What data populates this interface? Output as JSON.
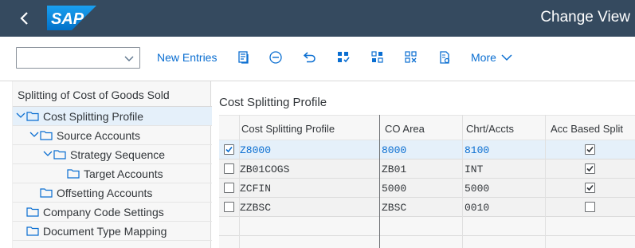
{
  "shell": {
    "title": "Change View",
    "logo_text": "SAP"
  },
  "toolbar": {
    "select_value": "",
    "new_entries": "New Entries",
    "more": "More",
    "icons": [
      "copy-as-icon",
      "delete-icon",
      "undo-icon",
      "select-all-icon",
      "select-block-icon",
      "deselect-all-icon",
      "print-icon"
    ]
  },
  "tree": {
    "header": "Splitting of Cost of Goods Sold",
    "items": [
      {
        "label": "Cost Splitting Profile",
        "level": 0,
        "expanded": true,
        "selected": true
      },
      {
        "label": "Source Accounts",
        "level": 1,
        "expanded": true
      },
      {
        "label": "Strategy Sequence",
        "level": 2,
        "expanded": true
      },
      {
        "label": "Target Accounts",
        "level": 3
      },
      {
        "label": "Offsetting Accounts",
        "level": 1
      },
      {
        "label": "Company Code Settings",
        "level": 0
      },
      {
        "label": "Document Type Mapping",
        "level": 0
      }
    ]
  },
  "table": {
    "title": "Cost Splitting Profile",
    "columns": [
      "Cost Splitting Profile",
      "CO Area",
      "Chrt/Accts",
      "Acc Based Split"
    ],
    "rows": [
      {
        "selected": true,
        "profile": "Z8000",
        "co_area": "8000",
        "chart": "8100",
        "acc_split": true
      },
      {
        "selected": false,
        "profile": "ZB01COGS",
        "co_area": "ZB01",
        "chart": "INT",
        "acc_split": true
      },
      {
        "selected": false,
        "profile": "ZCFIN",
        "co_area": "5000",
        "chart": "5000",
        "acc_split": true
      },
      {
        "selected": false,
        "profile": "ZZBSC",
        "co_area": "ZBSC",
        "chart": "0010",
        "acc_split": false
      }
    ]
  },
  "colors": {
    "shell": "#354a5f",
    "link": "#0a6ed1",
    "selection": "#e5f0fa"
  }
}
